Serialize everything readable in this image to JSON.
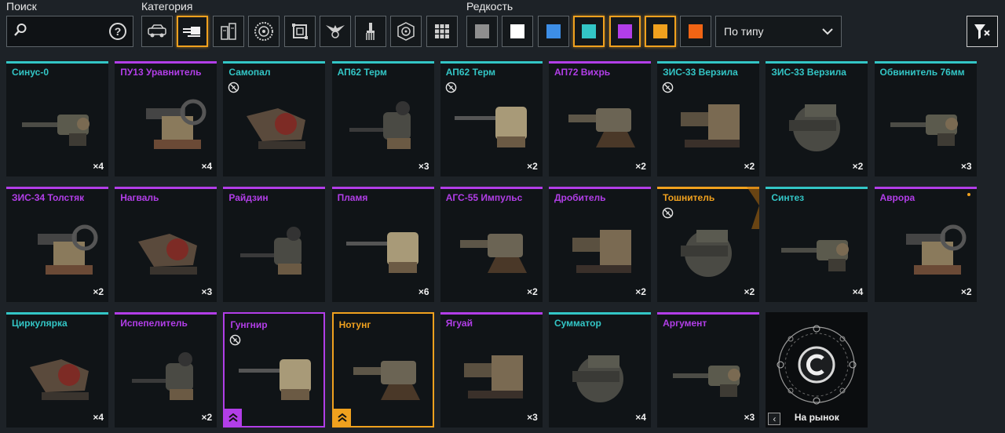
{
  "labels": {
    "search": "Поиск",
    "category": "Категория",
    "rarity": "Редкость"
  },
  "search": {
    "placeholder": "",
    "value": ""
  },
  "categories": [
    {
      "icon": "vehicle-icon",
      "active": false
    },
    {
      "icon": "weapon-icon",
      "active": true
    },
    {
      "icon": "module-icon",
      "active": false
    },
    {
      "icon": "wheel-icon",
      "active": false
    },
    {
      "icon": "structure-icon",
      "active": false
    },
    {
      "icon": "faction-emblem-icon",
      "active": false
    },
    {
      "icon": "paint-brush-icon",
      "active": false
    },
    {
      "icon": "resource-icon",
      "active": false
    },
    {
      "icon": "grid-all-icon",
      "active": false
    }
  ],
  "rarities": [
    {
      "color": "#8e8e8e",
      "active": false
    },
    {
      "color": "#ffffff",
      "active": false
    },
    {
      "color": "#3d8ee6",
      "active": false
    },
    {
      "color": "#33c6c6",
      "active": true
    },
    {
      "color": "#b23ee8",
      "active": true
    },
    {
      "color": "#f0a11e",
      "active": true
    },
    {
      "color": "#f06414",
      "active": false
    }
  ],
  "sort": {
    "value": "По типу"
  },
  "rarity_colors": {
    "rare": "#33c6c6",
    "epic": "#b23ee8",
    "legendary": "#f0a11e"
  },
  "items": [
    {
      "name": "Синус-0",
      "rarity": "rare",
      "count": "×4",
      "broken": false
    },
    {
      "name": "ПУ13 Уравнитель",
      "rarity": "epic",
      "count": "×4",
      "broken": false
    },
    {
      "name": "Самопал",
      "rarity": "rare",
      "count": "",
      "broken": true
    },
    {
      "name": "АП62 Терм",
      "rarity": "rare",
      "count": "×3",
      "broken": false
    },
    {
      "name": "АП62 Терм",
      "rarity": "rare",
      "count": "×2",
      "broken": true
    },
    {
      "name": "АП72 Вихрь",
      "rarity": "epic",
      "count": "×2",
      "broken": false
    },
    {
      "name": "ЗИС-33 Верзила",
      "rarity": "rare",
      "count": "×2",
      "broken": true
    },
    {
      "name": "ЗИС-33 Верзила",
      "rarity": "rare",
      "count": "×2",
      "broken": false
    },
    {
      "name": "Обвинитель 76мм",
      "rarity": "rare",
      "count": "×3",
      "broken": false
    },
    {
      "name": "ЗИС-34 Толстяк",
      "rarity": "epic",
      "count": "×2",
      "broken": false
    },
    {
      "name": "Нагваль",
      "rarity": "epic",
      "count": "×3",
      "broken": false
    },
    {
      "name": "Райдзин",
      "rarity": "epic",
      "count": "",
      "broken": false
    },
    {
      "name": "Пламя",
      "rarity": "epic",
      "count": "×6",
      "broken": false
    },
    {
      "name": "АГС-55 Импульс",
      "rarity": "epic",
      "count": "×2",
      "broken": false
    },
    {
      "name": "Дробитель",
      "rarity": "epic",
      "count": "×2",
      "broken": false
    },
    {
      "name": "Тошнитель",
      "rarity": "legendary",
      "count": "×2",
      "broken": true,
      "faction_bg": true
    },
    {
      "name": "Синтез",
      "rarity": "rare",
      "count": "×4",
      "broken": false
    },
    {
      "name": "Аврора",
      "rarity": "epic",
      "count": "×2",
      "broken": false,
      "dot": true
    },
    {
      "name": "Циркулярка",
      "rarity": "rare",
      "count": "×4",
      "broken": false
    },
    {
      "name": "Испепелитель",
      "rarity": "epic",
      "count": "×2",
      "broken": false
    },
    {
      "name": "Гунгнир",
      "rarity": "epic",
      "count": "",
      "broken": true,
      "outlined": true,
      "upgrade": true
    },
    {
      "name": "Нотунг",
      "rarity": "legendary",
      "count": "",
      "broken": false,
      "outlined": true,
      "upgrade": true
    },
    {
      "name": "Ягуай",
      "rarity": "epic",
      "count": "×3",
      "broken": false
    },
    {
      "name": "Сумматор",
      "rarity": "rare",
      "count": "×4",
      "broken": false
    },
    {
      "name": "Аргумент",
      "rarity": "epic",
      "count": "×3",
      "broken": false
    }
  ],
  "market": {
    "label": "На рынок"
  }
}
